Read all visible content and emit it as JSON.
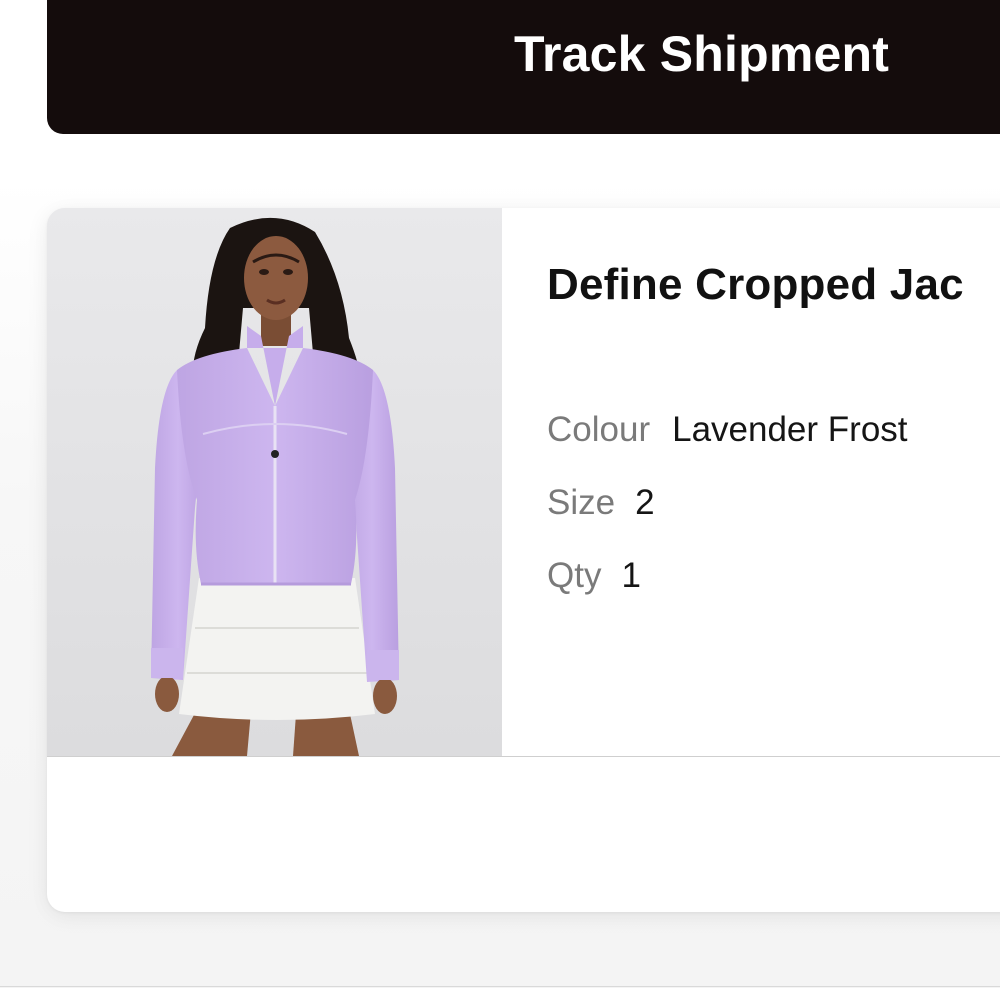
{
  "header": {
    "track_button_label": "Track Shipment"
  },
  "product": {
    "title": "Define Cropped Jac",
    "attributes": {
      "colour_label": "Colour",
      "colour_value": "Lavender Frost",
      "size_label": "Size",
      "size_value": "2",
      "qty_label": "Qty",
      "qty_value": "1"
    },
    "image_subject": "woman-in-lavender-cropped-jacket-and-white-skirt"
  },
  "colors": {
    "header_bg": "#140c0c",
    "jacket": "#c9b1ea",
    "label_gray": "#7a7a7a"
  }
}
